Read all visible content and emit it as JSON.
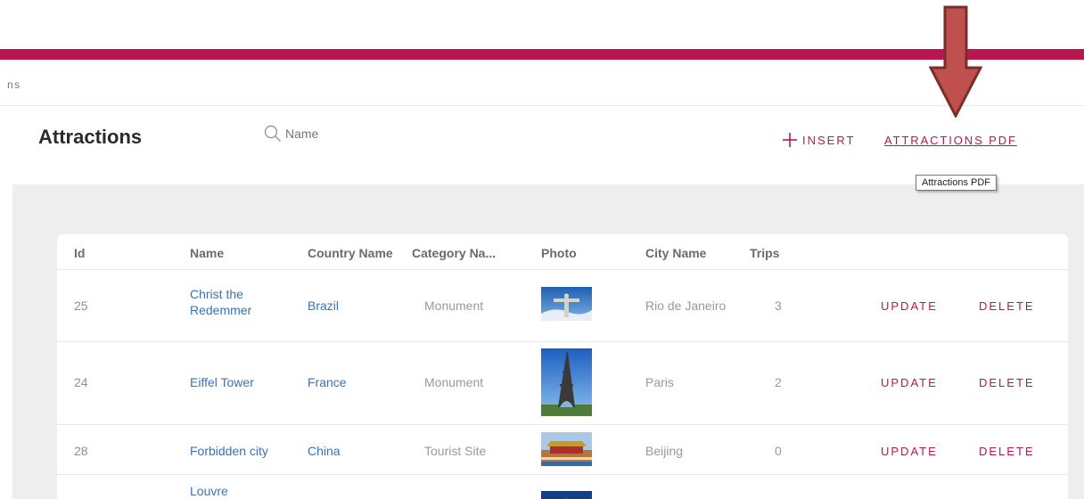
{
  "breadcrumb": "ns",
  "header": {
    "title": "Attractions",
    "search_placeholder": "Name",
    "insert_label": "INSERT",
    "pdf_label": "ATTRACTIONS PDF",
    "tooltip": "Attractions PDF"
  },
  "colors": {
    "accent": "#b9164f",
    "link": "#3a73b4",
    "arrow": "#c0504d"
  },
  "table": {
    "columns": [
      "Id",
      "Name",
      "Country Name",
      "Category Na...",
      "Photo",
      "City Name",
      "Trips"
    ],
    "rows": [
      {
        "id": "25",
        "name_line1": "Christ the",
        "name_line2": "Redemmer",
        "country": "Brazil",
        "category": "Monument",
        "photo_icon": "christ-the-redeemer-photo",
        "city": "Rio de Janeiro",
        "trips": "3",
        "update": "UPDATE",
        "delete": "DELETE"
      },
      {
        "id": "24",
        "name": "Eiffel Tower",
        "country": "France",
        "category": "Monument",
        "photo_icon": "eiffel-tower-photo",
        "city": "Paris",
        "trips": "2",
        "update": "UPDATE",
        "delete": "DELETE"
      },
      {
        "id": "28",
        "name": "Forbidden city",
        "country": "China",
        "category": "Tourist Site",
        "photo_icon": "forbidden-city-photo",
        "city": "Beijing",
        "trips": "0",
        "update": "UPDATE",
        "delete": "DELETE"
      },
      {
        "name_partial": "Louvre",
        "photo_icon": "louvre-photo"
      }
    ]
  }
}
